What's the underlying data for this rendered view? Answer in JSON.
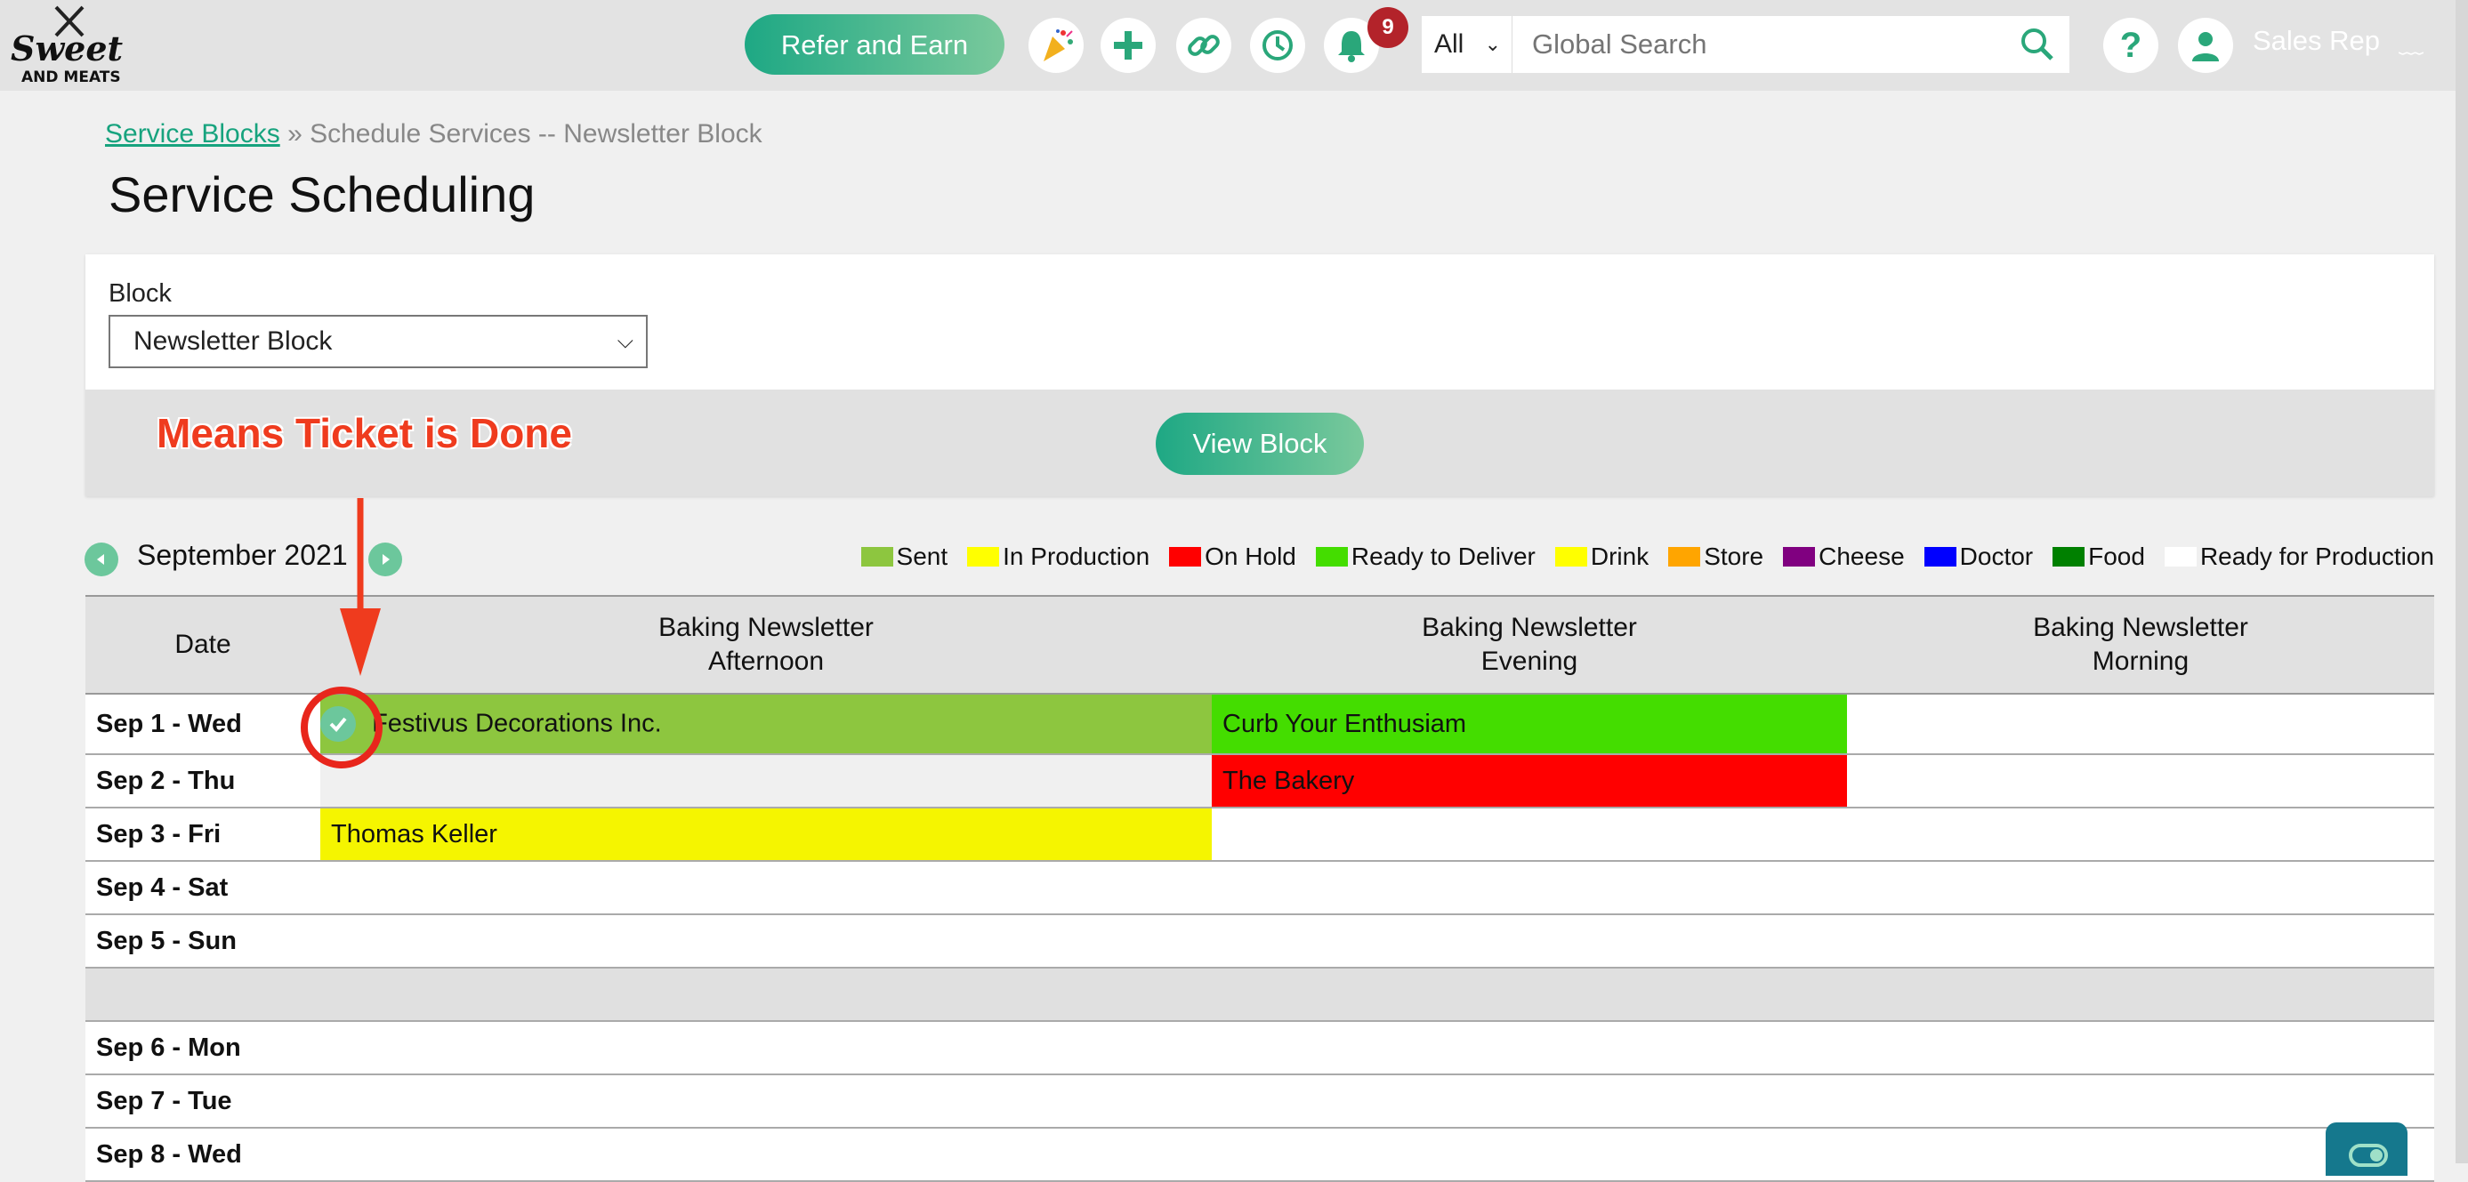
{
  "header": {
    "logo": "Sweets And Meats",
    "refer_label": "Refer and Earn",
    "notification_count": "9",
    "search_scope": "All",
    "search_placeholder": "Global Search",
    "user_name": "Sales Rep",
    "icons": [
      "party-icon",
      "plus-icon",
      "link-icon",
      "history-icon",
      "bell-icon",
      "search-icon",
      "help-icon",
      "user-icon"
    ]
  },
  "breadcrumb": {
    "link": "Service Blocks",
    "separator": "»",
    "current": "Schedule Services -- Newsletter Block"
  },
  "page_title": "Service Scheduling",
  "block_panel": {
    "label": "Block",
    "selected": "Newsletter Block",
    "view_button": "View Block"
  },
  "annotation": {
    "text": "Means Ticket is Done",
    "color": "#ef3b1e"
  },
  "calendar": {
    "month": "September 2021",
    "legend": [
      {
        "label": "Sent",
        "color": "#8dc63f"
      },
      {
        "label": "In Production",
        "color": "#ffff00"
      },
      {
        "label": "On Hold",
        "color": "#ff0000"
      },
      {
        "label": "Ready to Deliver",
        "color": "#44dd00"
      },
      {
        "label": "Drink",
        "color": "#ffff00"
      },
      {
        "label": "Store",
        "color": "#ffa500"
      },
      {
        "label": "Cheese",
        "color": "#800080"
      },
      {
        "label": "Doctor",
        "color": "#0000ff"
      },
      {
        "label": "Food",
        "color": "#008000"
      },
      {
        "label": "Ready for Production",
        "color": "#ffffff"
      }
    ],
    "columns": {
      "date": "Date",
      "afternoon_1": "Baking Newsletter",
      "afternoon_2": "Afternoon",
      "evening_1": "Baking Newsletter",
      "evening_2": "Evening",
      "morning_1": "Baking Newsletter",
      "morning_2": "Morning"
    },
    "rows": [
      {
        "date": "Sep 1 - Wed",
        "afternoon": "Festivus Decorations Inc.",
        "evening": "Curb Your Enthusiam",
        "morning": ""
      },
      {
        "date": "Sep 2 - Thu",
        "afternoon": "",
        "evening": "The Bakery",
        "morning": ""
      },
      {
        "date": "Sep 3 - Fri",
        "afternoon": "Thomas Keller",
        "evening": "",
        "morning": ""
      },
      {
        "date": "Sep 4 - Sat",
        "afternoon": "",
        "evening": "",
        "morning": ""
      },
      {
        "date": "Sep 5 - Sun",
        "afternoon": "",
        "evening": "",
        "morning": ""
      },
      {
        "date": "Sep 6 - Mon",
        "afternoon": "",
        "evening": "",
        "morning": ""
      },
      {
        "date": "Sep 7 - Tue",
        "afternoon": "",
        "evening": "",
        "morning": ""
      },
      {
        "date": "Sep 8 - Wed",
        "afternoon": "",
        "evening": "",
        "morning": ""
      }
    ],
    "cell_colors": {
      "sent": "#8dc63f",
      "ready_to_deliver": "#44dd00",
      "on_hold": "#ff0000",
      "in_production": "#f5f500"
    }
  }
}
